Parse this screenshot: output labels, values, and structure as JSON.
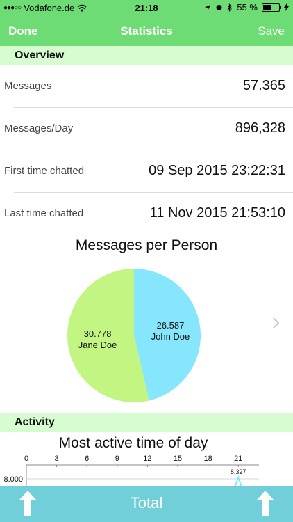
{
  "status": {
    "carrier": "Vodafone.de",
    "time": "21:18",
    "battery": "55 %",
    "battery_level": 0.55
  },
  "nav": {
    "done": "Done",
    "title": "Statistics",
    "save": "Save"
  },
  "overview": {
    "header": "Overview",
    "rows": [
      {
        "label": "Messages",
        "value": "57.365"
      },
      {
        "label": "Messages/Day",
        "value": "896,328"
      },
      {
        "label": "First time chatted",
        "value": "09 Sep 2015 23:22:31"
      },
      {
        "label": "Last time chatted",
        "value": "11 Nov 2015 21:53:10"
      }
    ]
  },
  "pie": {
    "title": "Messages per Person"
  },
  "activity": {
    "header": "Activity",
    "title": "Most active time of day"
  },
  "bottom": {
    "total": "Total"
  },
  "colors": {
    "green": "#6edc74",
    "section": "#d6fcd0",
    "teal": "#70cfd9",
    "pie_green": "#c3f582",
    "pie_blue": "#85e6fc"
  },
  "chart_data": [
    {
      "type": "pie",
      "title": "Messages per Person",
      "series": [
        {
          "name": "Jane Doe",
          "value": 30778,
          "label": "30.778",
          "color": "#c3f582"
        },
        {
          "name": "John Doe",
          "value": 26587,
          "label": "26.587",
          "color": "#85e6fc"
        }
      ]
    },
    {
      "type": "line",
      "title": "Most active time of day",
      "x_ticks": [
        "0",
        "3",
        "6",
        "9",
        "12",
        "15",
        "18",
        "21"
      ],
      "y_tick": "8.000",
      "peak": {
        "x": 21,
        "y": 8327,
        "label": "8.327"
      }
    }
  ]
}
